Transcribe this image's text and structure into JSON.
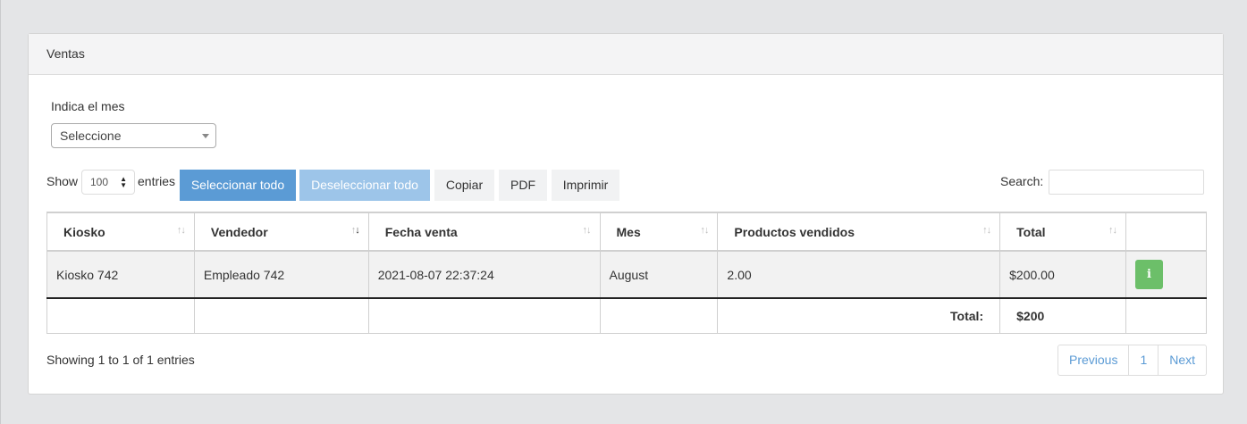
{
  "panel": {
    "title": "Ventas"
  },
  "filter": {
    "label": "Indica el mes",
    "selected": "Seleccione"
  },
  "length": {
    "show": "Show",
    "value": "100",
    "entries": "entries"
  },
  "buttons": {
    "select_all": "Seleccionar todo",
    "deselect_all": "Deseleccionar todo",
    "copy": "Copiar",
    "pdf": "PDF",
    "print": "Imprimir"
  },
  "search": {
    "label": "Search:",
    "value": ""
  },
  "table": {
    "headers": [
      "Kiosko",
      "Vendedor",
      "Fecha venta",
      "Mes",
      "Productos vendidos",
      "Total"
    ],
    "rows": [
      {
        "kiosko": "Kiosko 742",
        "vendedor": "Empleado 742",
        "fecha": "2021-08-07 22:37:24",
        "mes": "August",
        "productos": "2.00",
        "total": "$200.00",
        "action_icon": "info-icon"
      }
    ],
    "footer": {
      "label": "Total:",
      "value": "$200"
    }
  },
  "info": "Showing 1 to 1 of 1 entries",
  "pagination": {
    "previous": "Previous",
    "page": "1",
    "next": "Next"
  },
  "colors": {
    "primary": "#5b9bd5",
    "primary_disabled": "#9dc5e9",
    "success": "#6cbf69"
  }
}
